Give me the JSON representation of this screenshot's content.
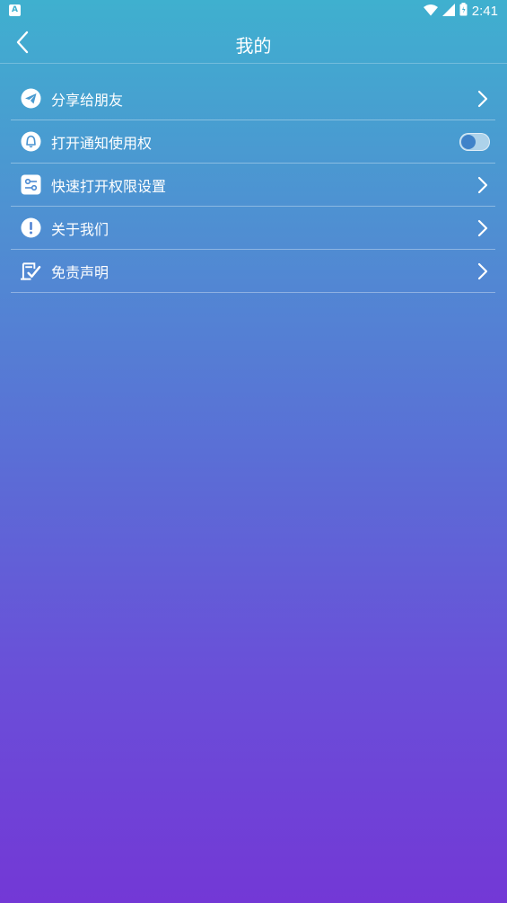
{
  "status_bar": {
    "left_badge": "A",
    "time": "2:41",
    "icons": [
      "wifi-icon",
      "cell-signal-icon",
      "battery-icon"
    ]
  },
  "header": {
    "title": "我的",
    "back_icon": "back-arrow-icon"
  },
  "menu": {
    "items": [
      {
        "label": "分享给朋友",
        "icon": "share-send-icon",
        "control": "chevron"
      },
      {
        "label": "打开通知使用权",
        "icon": "bell-icon",
        "control": "toggle",
        "toggle_on": false
      },
      {
        "label": "快速打开权限设置",
        "icon": "settings-sliders-icon",
        "control": "chevron"
      },
      {
        "label": "关于我们",
        "icon": "info-exclamation-icon",
        "control": "chevron"
      },
      {
        "label": "免责声明",
        "icon": "signed-document-icon",
        "control": "chevron"
      }
    ]
  },
  "colors": {
    "gradient_top": "#3fb0cf",
    "gradient_bottom": "#7338d6",
    "toggle_knob": "#3f82c9"
  }
}
